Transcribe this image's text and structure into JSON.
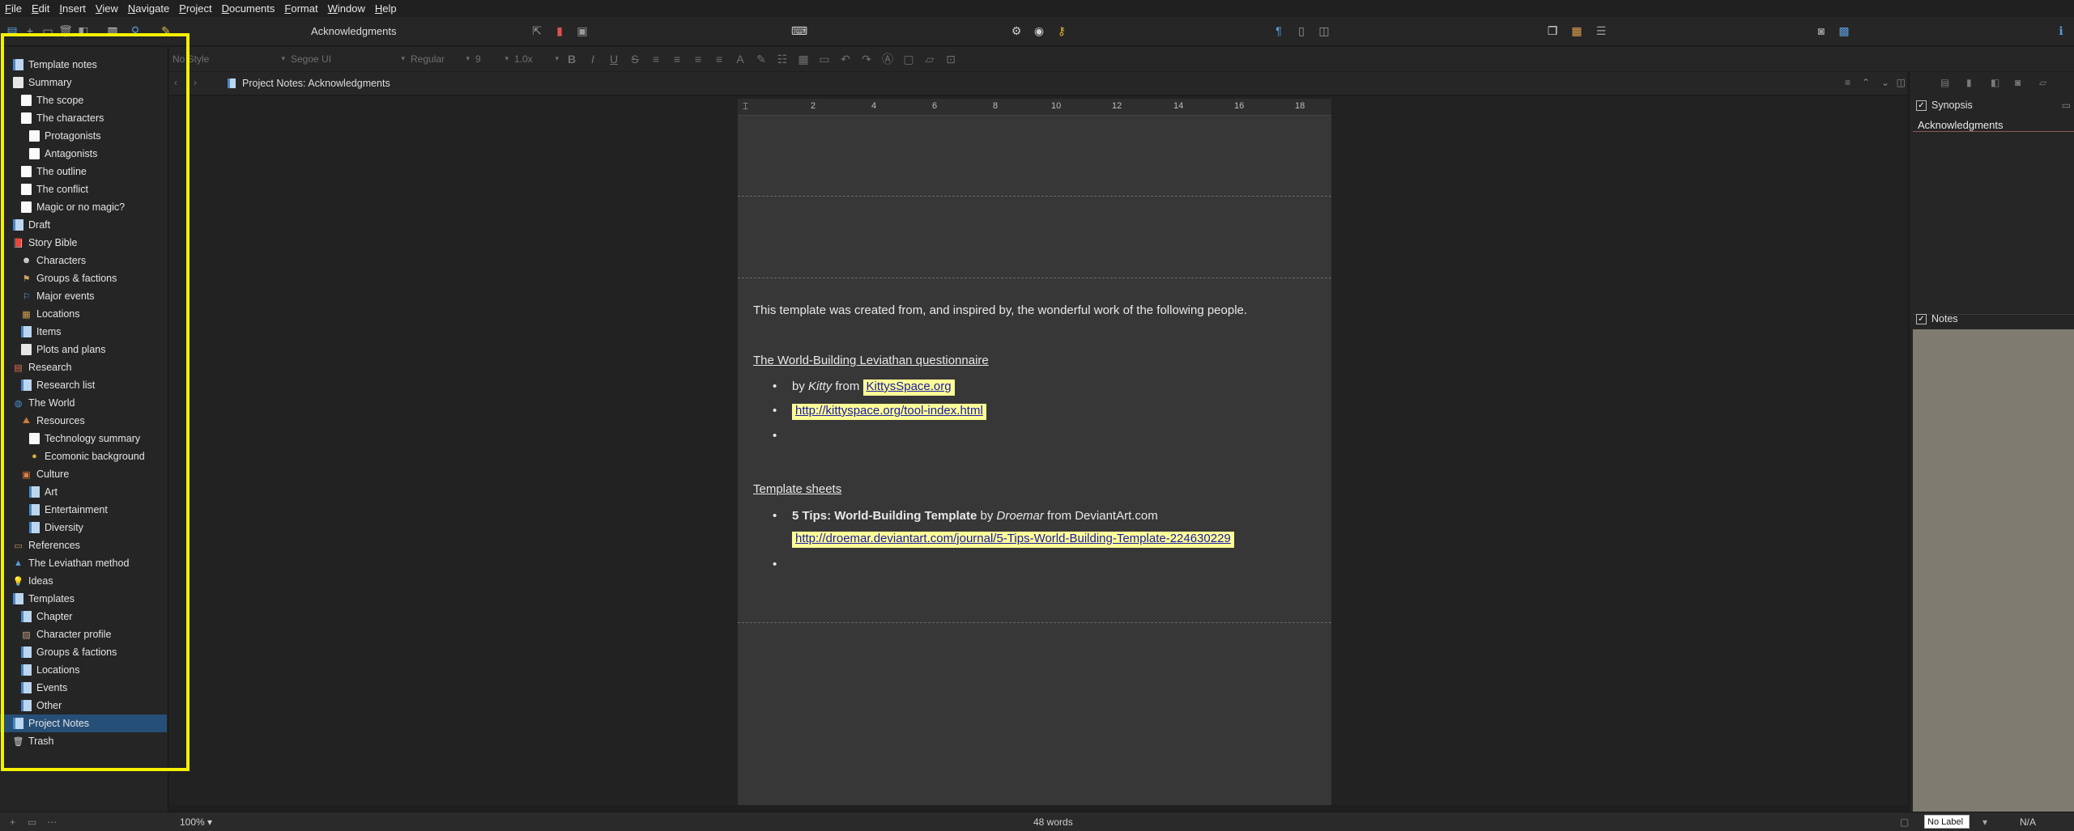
{
  "menu": [
    "File",
    "Edit",
    "Insert",
    "View",
    "Navigate",
    "Project",
    "Documents",
    "Format",
    "Window",
    "Help"
  ],
  "toolbar": {
    "document_title": "Acknowledgments"
  },
  "format_bar": {
    "style": "No Style",
    "font": "Segoe UI",
    "weight": "Regular",
    "size": "9",
    "line_spacing": "1.0x"
  },
  "binder": {
    "items": [
      {
        "label": "Template notes",
        "icon": "doc-notes-icon",
        "level": 0
      },
      {
        "label": "Summary",
        "icon": "folder-icon",
        "level": 0
      },
      {
        "label": "The scope",
        "icon": "doc-icon",
        "level": 1
      },
      {
        "label": "The characters",
        "icon": "doc-icon",
        "level": 1
      },
      {
        "label": "Protagonists",
        "icon": "doc-icon",
        "level": 2
      },
      {
        "label": "Antagonists",
        "icon": "doc-icon",
        "level": 2
      },
      {
        "label": "The outline",
        "icon": "doc-icon",
        "level": 1
      },
      {
        "label": "The conflict",
        "icon": "doc-icon",
        "level": 1
      },
      {
        "label": "Magic or no magic?",
        "icon": "doc-icon",
        "level": 1
      },
      {
        "label": "Draft",
        "icon": "draft-icon",
        "level": 0
      },
      {
        "label": "Story Bible",
        "icon": "bible-icon",
        "level": 0
      },
      {
        "label": "Characters",
        "icon": "mask-icon",
        "level": 1
      },
      {
        "label": "Groups & factions",
        "icon": "group-icon",
        "level": 1
      },
      {
        "label": "Major events",
        "icon": "flag-icon",
        "level": 1
      },
      {
        "label": "Locations",
        "icon": "building-icon",
        "level": 1
      },
      {
        "label": "Items",
        "icon": "doc-notes-icon",
        "level": 1
      },
      {
        "label": "Plots and plans",
        "icon": "folder-icon",
        "level": 1
      },
      {
        "label": "Research",
        "icon": "research-icon",
        "level": 0
      },
      {
        "label": "Research list",
        "icon": "doc-notes-icon",
        "level": 1
      },
      {
        "label": "The World",
        "icon": "globe-icon",
        "level": 0
      },
      {
        "label": "Resources",
        "icon": "resources-icon",
        "level": 1
      },
      {
        "label": "Technology summary",
        "icon": "doc-icon",
        "level": 2
      },
      {
        "label": "Ecomonic background",
        "icon": "coin-icon",
        "level": 2
      },
      {
        "label": "Culture",
        "icon": "culture-icon",
        "level": 1
      },
      {
        "label": "Art",
        "icon": "doc-notes-icon",
        "level": 2
      },
      {
        "label": "Entertainment",
        "icon": "doc-notes-icon",
        "level": 2
      },
      {
        "label": "Diversity",
        "icon": "doc-notes-icon",
        "level": 2
      },
      {
        "label": "References",
        "icon": "references-icon",
        "level": 0
      },
      {
        "label": "The Leviathan method",
        "icon": "pyramid-icon",
        "level": 0
      },
      {
        "label": "Ideas",
        "icon": "lightbulb-icon",
        "level": 0
      },
      {
        "label": "Templates",
        "icon": "templates-icon",
        "level": 0
      },
      {
        "label": "Chapter",
        "icon": "template-doc-icon",
        "level": 1
      },
      {
        "label": "Character profile",
        "icon": "template-person-icon",
        "level": 1
      },
      {
        "label": "Groups & factions",
        "icon": "template-doc-icon",
        "level": 1
      },
      {
        "label": "Locations",
        "icon": "template-doc-icon",
        "level": 1
      },
      {
        "label": "Events",
        "icon": "template-doc-icon",
        "level": 1
      },
      {
        "label": "Other",
        "icon": "template-doc-icon",
        "level": 1
      },
      {
        "label": "Project Notes",
        "icon": "doc-notes-icon",
        "level": 0,
        "selected": true
      },
      {
        "label": "Trash",
        "icon": "trash-icon",
        "level": 0
      }
    ]
  },
  "breadcrumb": "Project Notes: Acknowledgments",
  "document": {
    "intro": "This template was created from, and inspired by, the wonderful work of the following people.",
    "section1_title": "The World-Building Leviathan questionnaire",
    "s1_by": "by ",
    "s1_author": "Kitty",
    "s1_from": " from ",
    "s1_site": "KittysSpace.org",
    "s1_link": "http://kittyspace.org/tool-index.html",
    "section2_title": "Template sheets",
    "s2_title": "5 Tips: World-Building Template",
    "s2_by": " by ",
    "s2_author": "Droemar",
    "s2_from": " from DeviantArt.com",
    "s2_link": "http://droemar.deviantart.com/journal/5-Tips-World-Building-Template-224630229"
  },
  "ruler_ticks": [
    "2",
    "4",
    "6",
    "8",
    "10",
    "12",
    "14",
    "16",
    "18"
  ],
  "inspector": {
    "synopsis_label": "Synopsis",
    "synopsis_title": "Acknowledgments",
    "notes_label": "Notes"
  },
  "footer": {
    "zoom": "100%",
    "word_count": "48 words",
    "label": "No Label",
    "status": "N/A"
  },
  "colors": {
    "selection": "#264f78",
    "highlight": "#fdfd96",
    "notes_bg": "#7f7b70",
    "accent_yellow": "#f5f000"
  }
}
